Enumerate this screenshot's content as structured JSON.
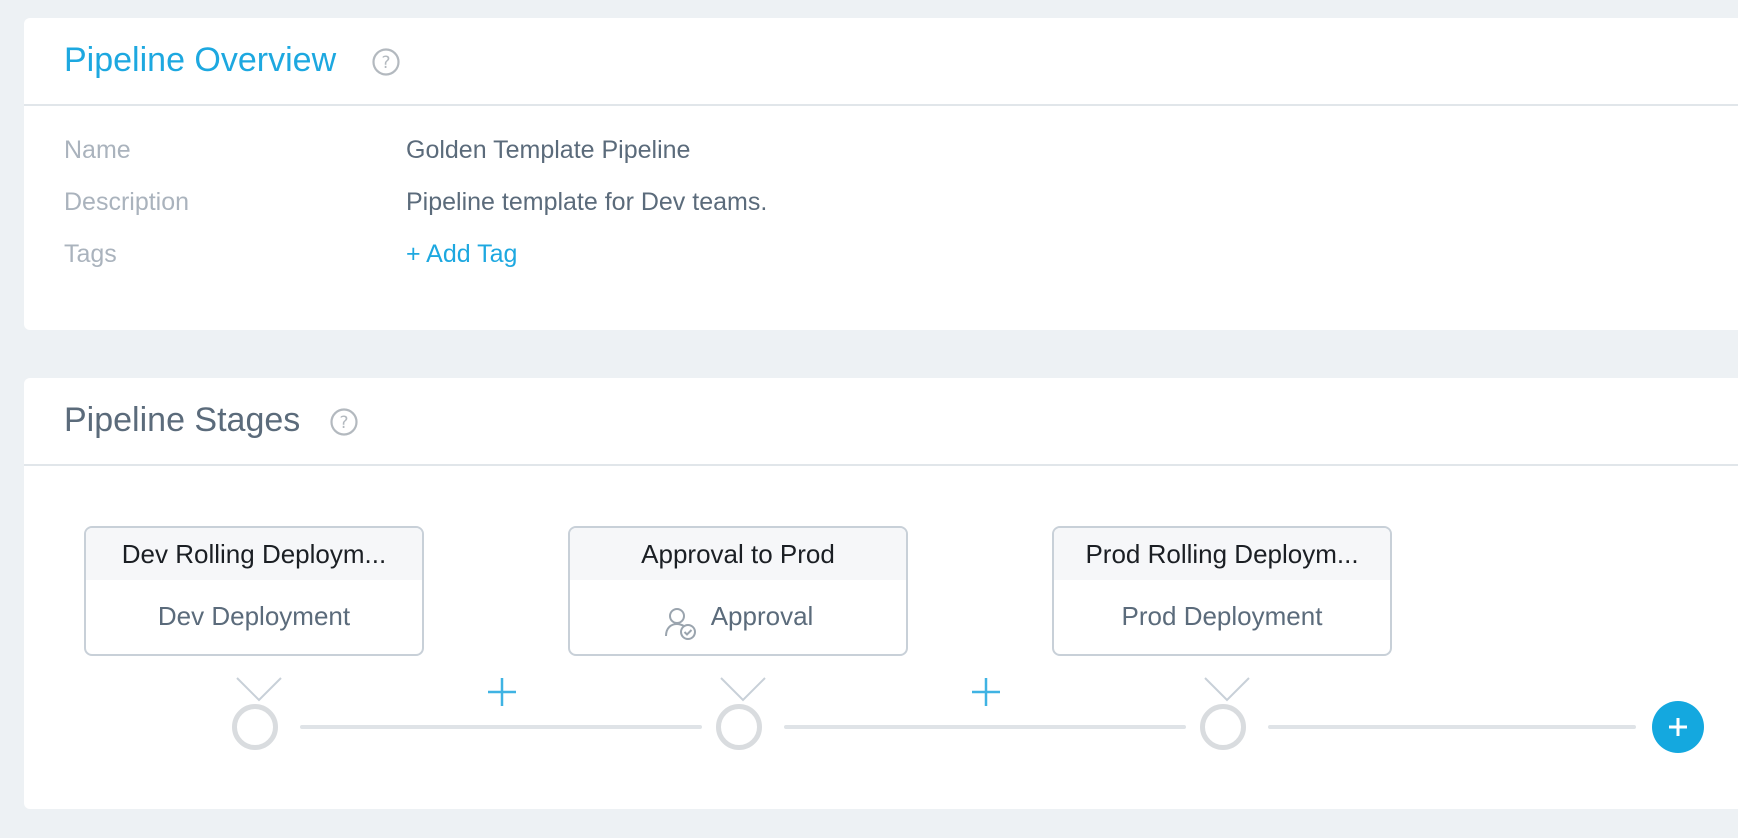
{
  "overview": {
    "title": "Pipeline Overview",
    "fields": {
      "name_label": "Name",
      "name_value": "Golden Template Pipeline",
      "description_label": "Description",
      "description_value": "Pipeline template for Dev teams.",
      "tags_label": "Tags",
      "add_tag_label": "+ Add Tag"
    },
    "help_icon": "question-circle-icon"
  },
  "stages_section": {
    "title": "Pipeline Stages",
    "help_icon": "question-circle-icon",
    "stages": [
      {
        "name": "Dev Rolling Deploym...",
        "type": "Dev Deployment"
      },
      {
        "name": "Approval to Prod",
        "type": "Approval",
        "type_icon": "user-check-icon"
      },
      {
        "name": "Prod Rolling Deploym...",
        "type": "Prod Deployment"
      }
    ],
    "insert_icon": "plus-icon",
    "add_stage_icon": "plus-icon"
  },
  "colors": {
    "accent": "#1da8e0",
    "background": "#edf1f4",
    "text_secondary": "#5b6b7b",
    "label_muted": "#aab3bd"
  }
}
